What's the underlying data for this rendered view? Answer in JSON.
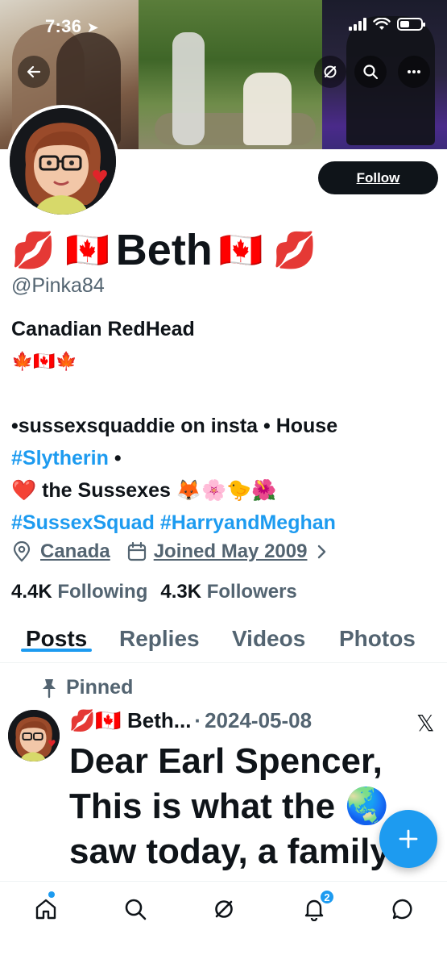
{
  "status_bar": {
    "time": "7:36"
  },
  "profile": {
    "display_name": {
      "prefix_emoji": "💋 🇨🇦",
      "name": "Beth",
      "suffix_emoji": "🇨🇦 💋"
    },
    "handle": "@Pinka84",
    "follow_label": "Follow",
    "bio": {
      "line1": "Canadian RedHead",
      "line2": "🍁🇨🇦🍁",
      "line3": "•sussexsquaddie on insta • House",
      "line4_hashtag": "#Slytherin",
      "line4_rest": " •",
      "line5": "❤️ the Sussexes 🦊🌸🐤🌺",
      "line6_hashtag1": "#SussexSquad",
      "line6_hashtag2": "#HarryandMeghan"
    },
    "location": "Canada",
    "joined": "Joined May 2009",
    "stats": {
      "following_count": "4.4K",
      "following_label": "Following",
      "followers_count": "4.3K",
      "followers_label": "Followers"
    }
  },
  "tabs": [
    {
      "label": "Posts",
      "active": true
    },
    {
      "label": "Replies"
    },
    {
      "label": "Videos"
    },
    {
      "label": "Photos"
    }
  ],
  "pinned_post": {
    "pinned_label": "Pinned",
    "author": "💋🇨🇦 Beth...",
    "separator": "·",
    "date": "2024-05-08",
    "source_logo": "𝕏",
    "text": "Dear Earl Spencer, This is what the 🌏 saw today, a family"
  },
  "bottom_nav": {
    "notifications_badge": "2",
    "icons": [
      "home-icon",
      "search-icon",
      "grok-icon",
      "notifications-icon",
      "messages-icon"
    ]
  },
  "colors": {
    "accent": "#1d9bf0",
    "text": "#0f1419",
    "muted": "#536471"
  }
}
